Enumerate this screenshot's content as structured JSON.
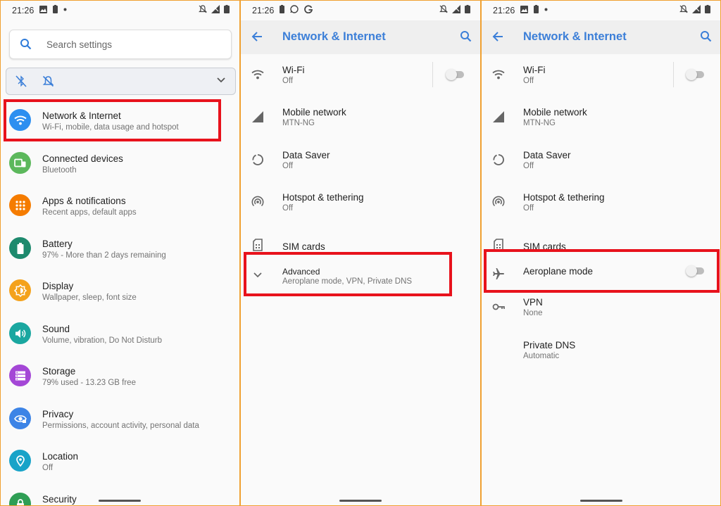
{
  "status": {
    "time": "21:26"
  },
  "panel1": {
    "search_placeholder": "Search settings",
    "items": [
      {
        "title": "Network & Internet",
        "subtitle": "Wi-Fi, mobile, data usage and hotspot",
        "color": "#2d8ff0",
        "icon": "wifi-icon"
      },
      {
        "title": "Connected devices",
        "subtitle": "Bluetooth",
        "color": "#5cb85c",
        "icon": "devices-icon"
      },
      {
        "title": "Apps & notifications",
        "subtitle": "Recent apps, default apps",
        "color": "#f57c00",
        "icon": "apps-icon"
      },
      {
        "title": "Battery",
        "subtitle": "97% - More than 2 days remaining",
        "color": "#1e8a6e",
        "icon": "battery-icon"
      },
      {
        "title": "Display",
        "subtitle": "Wallpaper, sleep, font size",
        "color": "#f4a21c",
        "icon": "display-icon"
      },
      {
        "title": "Sound",
        "subtitle": "Volume, vibration, Do Not Disturb",
        "color": "#1aa7a0",
        "icon": "sound-icon"
      },
      {
        "title": "Storage",
        "subtitle": "79% used - 13.23 GB free",
        "color": "#a447d6",
        "icon": "storage-icon"
      },
      {
        "title": "Privacy",
        "subtitle": "Permissions, account activity, personal data",
        "color": "#3d84e6",
        "icon": "privacy-icon"
      },
      {
        "title": "Location",
        "subtitle": "Off",
        "color": "#18a3c8",
        "icon": "location-icon"
      },
      {
        "title": "Security",
        "subtitle": "",
        "color": "#2f9e55",
        "icon": "security-icon"
      }
    ]
  },
  "panel2": {
    "title": "Network & Internet",
    "items": [
      {
        "title": "Wi-Fi",
        "subtitle": "Off",
        "icon": "wifi-icon"
      },
      {
        "title": "Mobile network",
        "subtitle": "MTN-NG",
        "icon": "signal-icon"
      },
      {
        "title": "Data Saver",
        "subtitle": "Off",
        "icon": "data-saver-icon"
      },
      {
        "title": "Hotspot & tethering",
        "subtitle": "Off",
        "icon": "hotspot-icon"
      },
      {
        "title": "SIM cards",
        "subtitle": "",
        "icon": "sim-icon"
      },
      {
        "title": "Advanced",
        "subtitle": "Aeroplane mode, VPN, Private DNS",
        "icon": "chevron-down-icon"
      }
    ]
  },
  "panel3": {
    "title": "Network & Internet",
    "items": [
      {
        "title": "Wi-Fi",
        "subtitle": "Off",
        "icon": "wifi-icon"
      },
      {
        "title": "Mobile network",
        "subtitle": "MTN-NG",
        "icon": "signal-icon"
      },
      {
        "title": "Data Saver",
        "subtitle": "Off",
        "icon": "data-saver-icon"
      },
      {
        "title": "Hotspot & tethering",
        "subtitle": "Off",
        "icon": "hotspot-icon"
      },
      {
        "title": "SIM cards",
        "subtitle": "",
        "icon": "sim-icon"
      },
      {
        "title": "Aeroplane mode",
        "subtitle": "",
        "icon": "airplane-icon"
      },
      {
        "title": "VPN",
        "subtitle": "None",
        "icon": "vpn-key-icon"
      },
      {
        "title": "Private DNS",
        "subtitle": "Automatic",
        "icon": ""
      }
    ]
  },
  "colors": {
    "accent": "#3c7fd8",
    "highlight": "#e8121c",
    "frame": "#f0a030"
  }
}
